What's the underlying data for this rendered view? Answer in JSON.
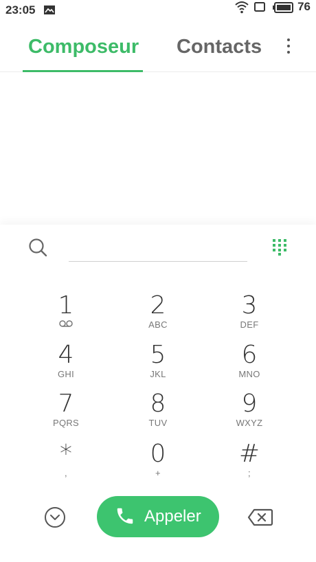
{
  "status": {
    "time": "23:05",
    "battery": "76"
  },
  "tabs": [
    {
      "label": "Composeur",
      "active": true
    },
    {
      "label": "Contacts",
      "active": false
    }
  ],
  "dialpad": {
    "keys": [
      {
        "digit": "1",
        "sub": ""
      },
      {
        "digit": "2",
        "sub": "ABC"
      },
      {
        "digit": "3",
        "sub": "DEF"
      },
      {
        "digit": "4",
        "sub": "GHI"
      },
      {
        "digit": "5",
        "sub": "JKL"
      },
      {
        "digit": "6",
        "sub": "MNO"
      },
      {
        "digit": "7",
        "sub": "PQRS"
      },
      {
        "digit": "8",
        "sub": "TUV"
      },
      {
        "digit": "9",
        "sub": "WXYZ"
      },
      {
        "digit": "*",
        "sub": ","
      },
      {
        "digit": "0",
        "sub": "+"
      },
      {
        "digit": "#",
        "sub": ";"
      }
    ]
  },
  "call_button": {
    "label": "Appeler"
  },
  "colors": {
    "accent": "#3dbb68",
    "call": "#3dc46f"
  }
}
